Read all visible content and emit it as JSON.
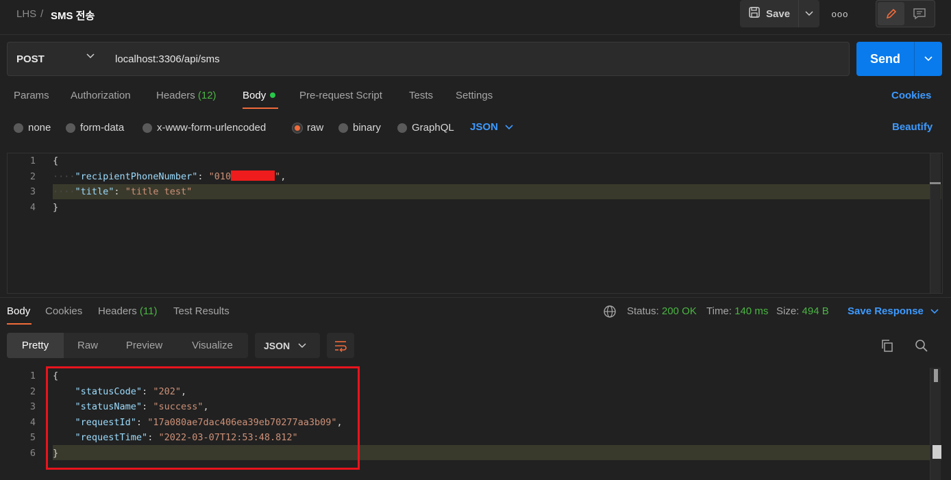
{
  "breadcrumb": {
    "workspace": "LHS",
    "separator": "/",
    "request_name": "SMS 전송"
  },
  "header": {
    "save_label": "Save",
    "more_label": "ooo"
  },
  "request": {
    "method": "POST",
    "url": "localhost:3306/api/sms",
    "send_label": "Send"
  },
  "request_tabs": [
    {
      "label": "Params"
    },
    {
      "label": "Authorization"
    },
    {
      "label": "Headers",
      "count": "(12)"
    },
    {
      "label": "Body"
    },
    {
      "label": "Pre-request Script"
    },
    {
      "label": "Tests"
    },
    {
      "label": "Settings"
    }
  ],
  "cookies_label": "Cookies",
  "body_types": [
    "none",
    "form-data",
    "x-www-form-urlencoded",
    "raw",
    "binary",
    "GraphQL"
  ],
  "body_format": "JSON",
  "beautify_label": "Beautify",
  "request_body": {
    "line_numbers": [
      "1",
      "2",
      "3",
      "4"
    ],
    "open": "{",
    "close": "}",
    "k1": "\"recipientPhoneNumber\"",
    "v1_prefix": "\"010",
    "v1_suffix": "\"",
    "k2": "\"title\"",
    "v2": "\"title test\""
  },
  "response_tabs": [
    {
      "label": "Body"
    },
    {
      "label": "Cookies"
    },
    {
      "label": "Headers",
      "count": "(11)"
    },
    {
      "label": "Test Results"
    }
  ],
  "response_meta": {
    "status_label": "Status:",
    "status_value": "200 OK",
    "time_label": "Time:",
    "time_value": "140 ms",
    "size_label": "Size:",
    "size_value": "494 B",
    "save_response_label": "Save Response"
  },
  "view_modes": [
    "Pretty",
    "Raw",
    "Preview",
    "Visualize"
  ],
  "response_format": "JSON",
  "response_body": {
    "line_numbers": [
      "1",
      "2",
      "3",
      "4",
      "5",
      "6"
    ],
    "open": "{",
    "close": "}",
    "fields": [
      {
        "key": "\"statusCode\"",
        "value": "\"202\""
      },
      {
        "key": "\"statusName\"",
        "value": "\"success\""
      },
      {
        "key": "\"requestId\"",
        "value": "\"17a080ae7dac406ea39eb70277aa3b09\""
      },
      {
        "key": "\"requestTime\"",
        "value": "\"2022-03-07T12:53:48.812\""
      }
    ]
  },
  "colors": {
    "accent": "#097bed",
    "tab_indicator": "#f26b3a",
    "link": "#3d9aff",
    "highlight_box": "#e8141c"
  }
}
